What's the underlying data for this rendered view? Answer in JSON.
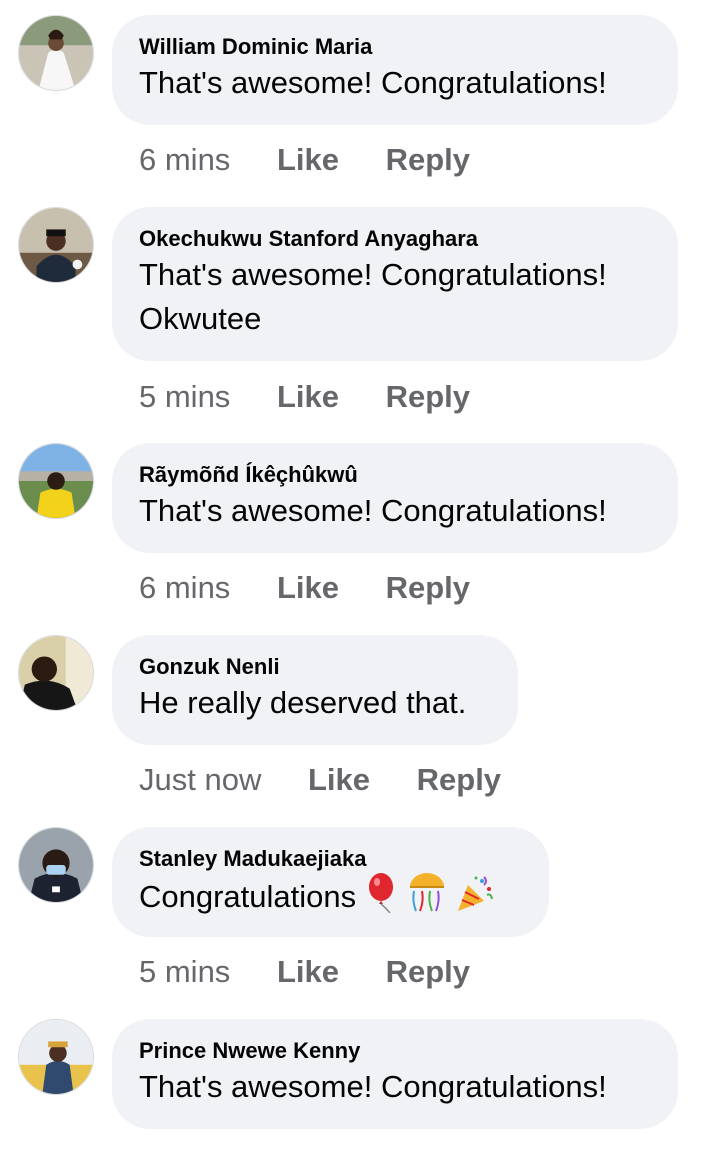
{
  "comments": [
    {
      "author": "William Dominic Maria",
      "text": "That's awesome! Congratulations!",
      "time": "6 mins",
      "like": "Like",
      "reply": "Reply"
    },
    {
      "author": "Okechukwu Stanford Anyaghara",
      "text": "That's awesome! Congratulations!\nOkwutee",
      "time": "5 mins",
      "like": "Like",
      "reply": "Reply"
    },
    {
      "author": "Rãymõñd Íkêçhûkwû",
      "text": "That's awesome! Congratulations!",
      "time": "6 mins",
      "like": "Like",
      "reply": "Reply"
    },
    {
      "author": "Gonzuk Nenli",
      "text": "He really deserved that.",
      "time": "Just now",
      "like": "Like",
      "reply": "Reply"
    },
    {
      "author": "Stanley Madukaejiaka",
      "text": "Congratulations",
      "emojis": [
        "balloon-emoji",
        "confetti-ball-emoji",
        "party-popper-emoji"
      ],
      "time": "5 mins",
      "like": "Like",
      "reply": "Reply"
    },
    {
      "author": "Prince Nwewe Kenny",
      "text": "That's awesome! Congratulations!",
      "time": "",
      "like": "",
      "reply": ""
    }
  ],
  "colors": {
    "bubble": "#f0f2f5",
    "meta_text": "#65676b",
    "body_text": "#050505"
  }
}
